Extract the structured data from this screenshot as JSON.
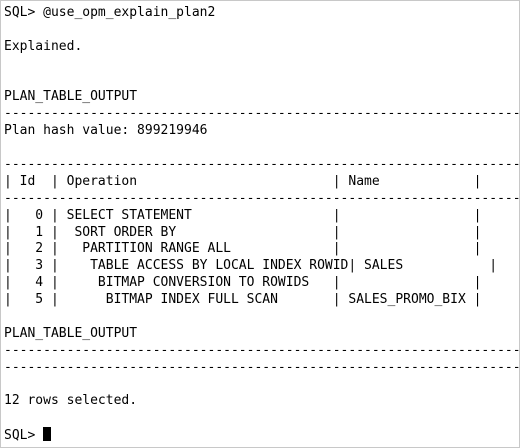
{
  "terminal": {
    "lines": [
      "SQL> @use_opm_explain_plan2",
      "",
      "Explained.",
      "",
      "",
      "PLAN_TABLE_OUTPUT",
      "------------------------------------------------------------------------",
      "Plan hash value: 899219946",
      "",
      "----------------------------------------------------------------------",
      "| Id  | Operation                         | Name            |",
      "----------------------------------------------------------------------",
      "|   0 | SELECT STATEMENT                  |                 |",
      "|   1 |  SORT ORDER BY                    |                 |",
      "|   2 |   PARTITION RANGE ALL             |                 |",
      "|   3 |    TABLE ACCESS BY LOCAL INDEX ROWID| SALES           |",
      "|   4 |     BITMAP CONVERSION TO ROWIDS   |                 |",
      "|   5 |      BITMAP INDEX FULL SCAN       | SALES_PROMO_BIX |",
      "",
      "PLAN_TABLE_OUTPUT",
      "------------------------------------------------------------------------",
      "----------------------------------------------------------------------",
      "",
      "12 rows selected.",
      "",
      "SQL> "
    ]
  }
}
